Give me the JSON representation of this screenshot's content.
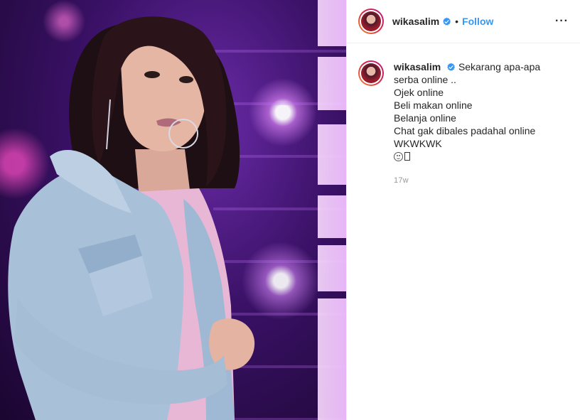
{
  "post": {
    "username": "wikasalim",
    "separator": "•",
    "follow_label": "Follow",
    "more_label": "···",
    "verified_icon": "verified-badge-icon",
    "caption": {
      "username": "wikasalim",
      "first_line": "Sekarang apa-apa serba online ..",
      "lines": [
        "Ojek online",
        "Beli makan online",
        "Belanja online",
        "Chat gak dibales padahal online",
        "WKWKWK"
      ],
      "emoji_line_icons": [
        "laughing-face-emoji-icon",
        "missing-glyph-box-icon"
      ]
    },
    "timestamp": "17w"
  },
  "colors": {
    "follow": "#3897f0",
    "verified": "#3897f0",
    "timestamp": "#999999",
    "text": "#262626",
    "photo_bg": "#3a1166"
  }
}
